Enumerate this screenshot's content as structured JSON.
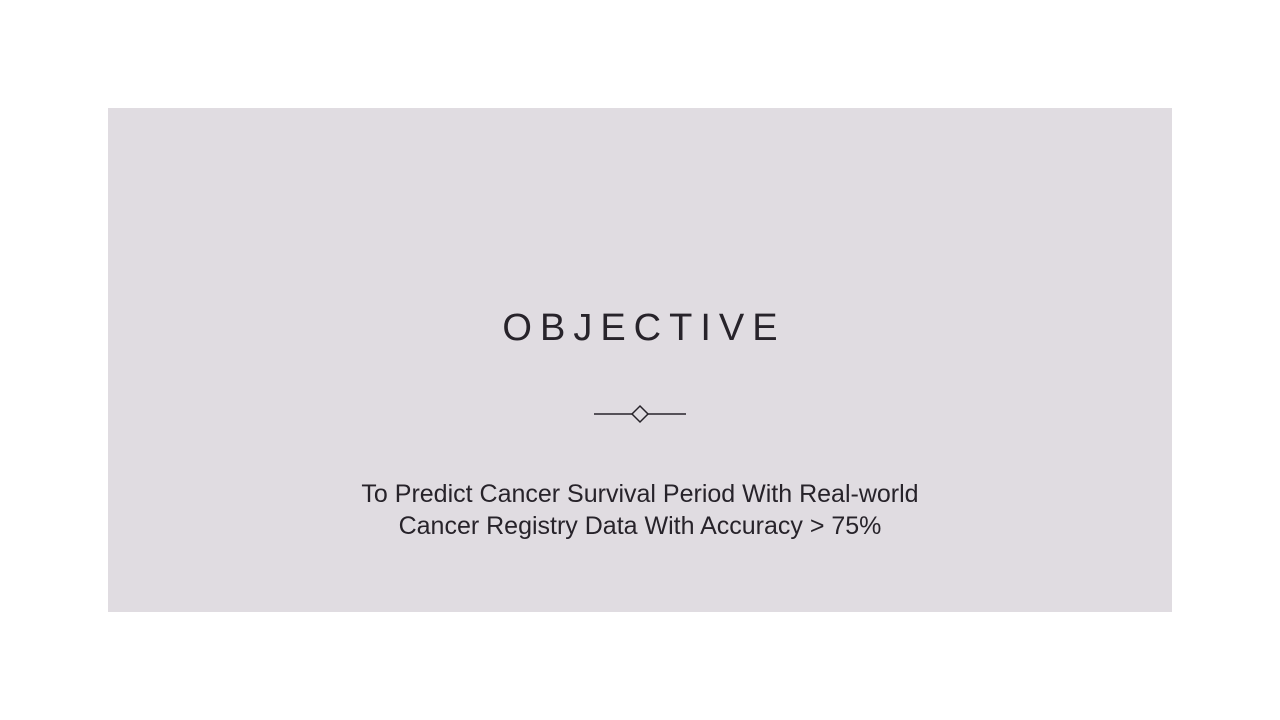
{
  "slide": {
    "title": "OBJECTIVE",
    "body_lines": [
      "To Predict Cancer Survival Period With  Real-world",
      "Cancer Registry Data With Accuracy > 75%"
    ]
  },
  "colors": {
    "page_background": "#ffffff",
    "panel_background": "#e0dce1",
    "text": "#27232a"
  },
  "icons": {
    "divider": "diamond-divider-icon"
  }
}
